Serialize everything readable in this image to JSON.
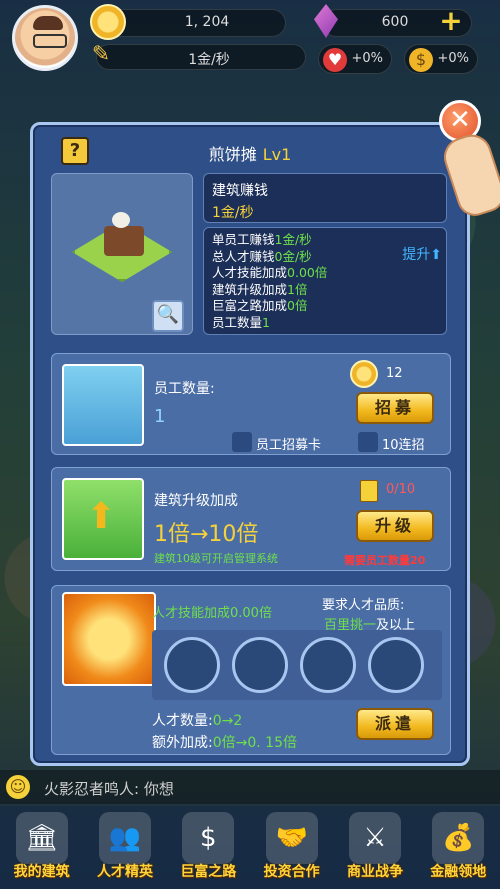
{
  "hud": {
    "coins": "1, 204",
    "gems": "600",
    "rate": "1金/秒",
    "buff_hearts": "+0%",
    "buff_coins": "+0%",
    "icons": [
      "avatar",
      "coin-icon",
      "gem-icon",
      "plus-icon",
      "pencil-icon",
      "heart-icon",
      "coin-bag-icon"
    ]
  },
  "panel": {
    "title": "煎饼摊",
    "level": "Lv1",
    "help": "?",
    "income_title": "建筑赚钱",
    "income_value": "1金/秒",
    "stats": {
      "per_staff_label": "单员工赚钱",
      "per_staff_value": "1金/秒",
      "talent_earn_label": "总人才赚钱",
      "talent_earn_value": "0金/秒",
      "talent_skill_label": "人才技能加成",
      "talent_skill_value": "0.00倍",
      "upgrade_bonus_label": "建筑升级加成",
      "upgrade_bonus_value": "1倍",
      "rich_path_label": "巨富之路加成",
      "rich_path_value": "0倍",
      "staff_count_label": "员工数量",
      "staff_count_value": "1"
    },
    "boost_label": "提升"
  },
  "staff_card": {
    "label": "员工数量:",
    "count": "1",
    "cost": "12",
    "recruit_button": "招募",
    "recruit_card_label": "员工招募卡",
    "ten_recruit_label": "10连招"
  },
  "upgrade_card": {
    "label": "建筑升级加成",
    "from_to": "1倍→10倍",
    "hint": "建筑10级可开启管理系统",
    "progress": "0/10",
    "upgrade_button": "升级",
    "requirement": "需要员工数量20"
  },
  "talent_card": {
    "skill_label": "人才技能加成0.00倍",
    "req_title": "要求人才品质:",
    "req_value": "百里挑一",
    "req_suffix": "及以上",
    "talent_count_label": "人才数量:",
    "talent_count_value": "0→2",
    "extra_label": "额外加成:",
    "extra_value": "0倍→0. 15倍",
    "dispatch_button": "派遣",
    "slots": 4
  },
  "chat": {
    "message": "火影忍者鸣人: 你想"
  },
  "tabs": [
    {
      "label": "我的建筑",
      "icon": "🏛"
    },
    {
      "label": "人才精英",
      "icon": "👥"
    },
    {
      "label": "巨富之路",
      "icon": "$"
    },
    {
      "label": "投资合作",
      "icon": "🤝"
    },
    {
      "label": "商业战争",
      "icon": "⚔"
    },
    {
      "label": "金融领地",
      "icon": "💰"
    }
  ]
}
